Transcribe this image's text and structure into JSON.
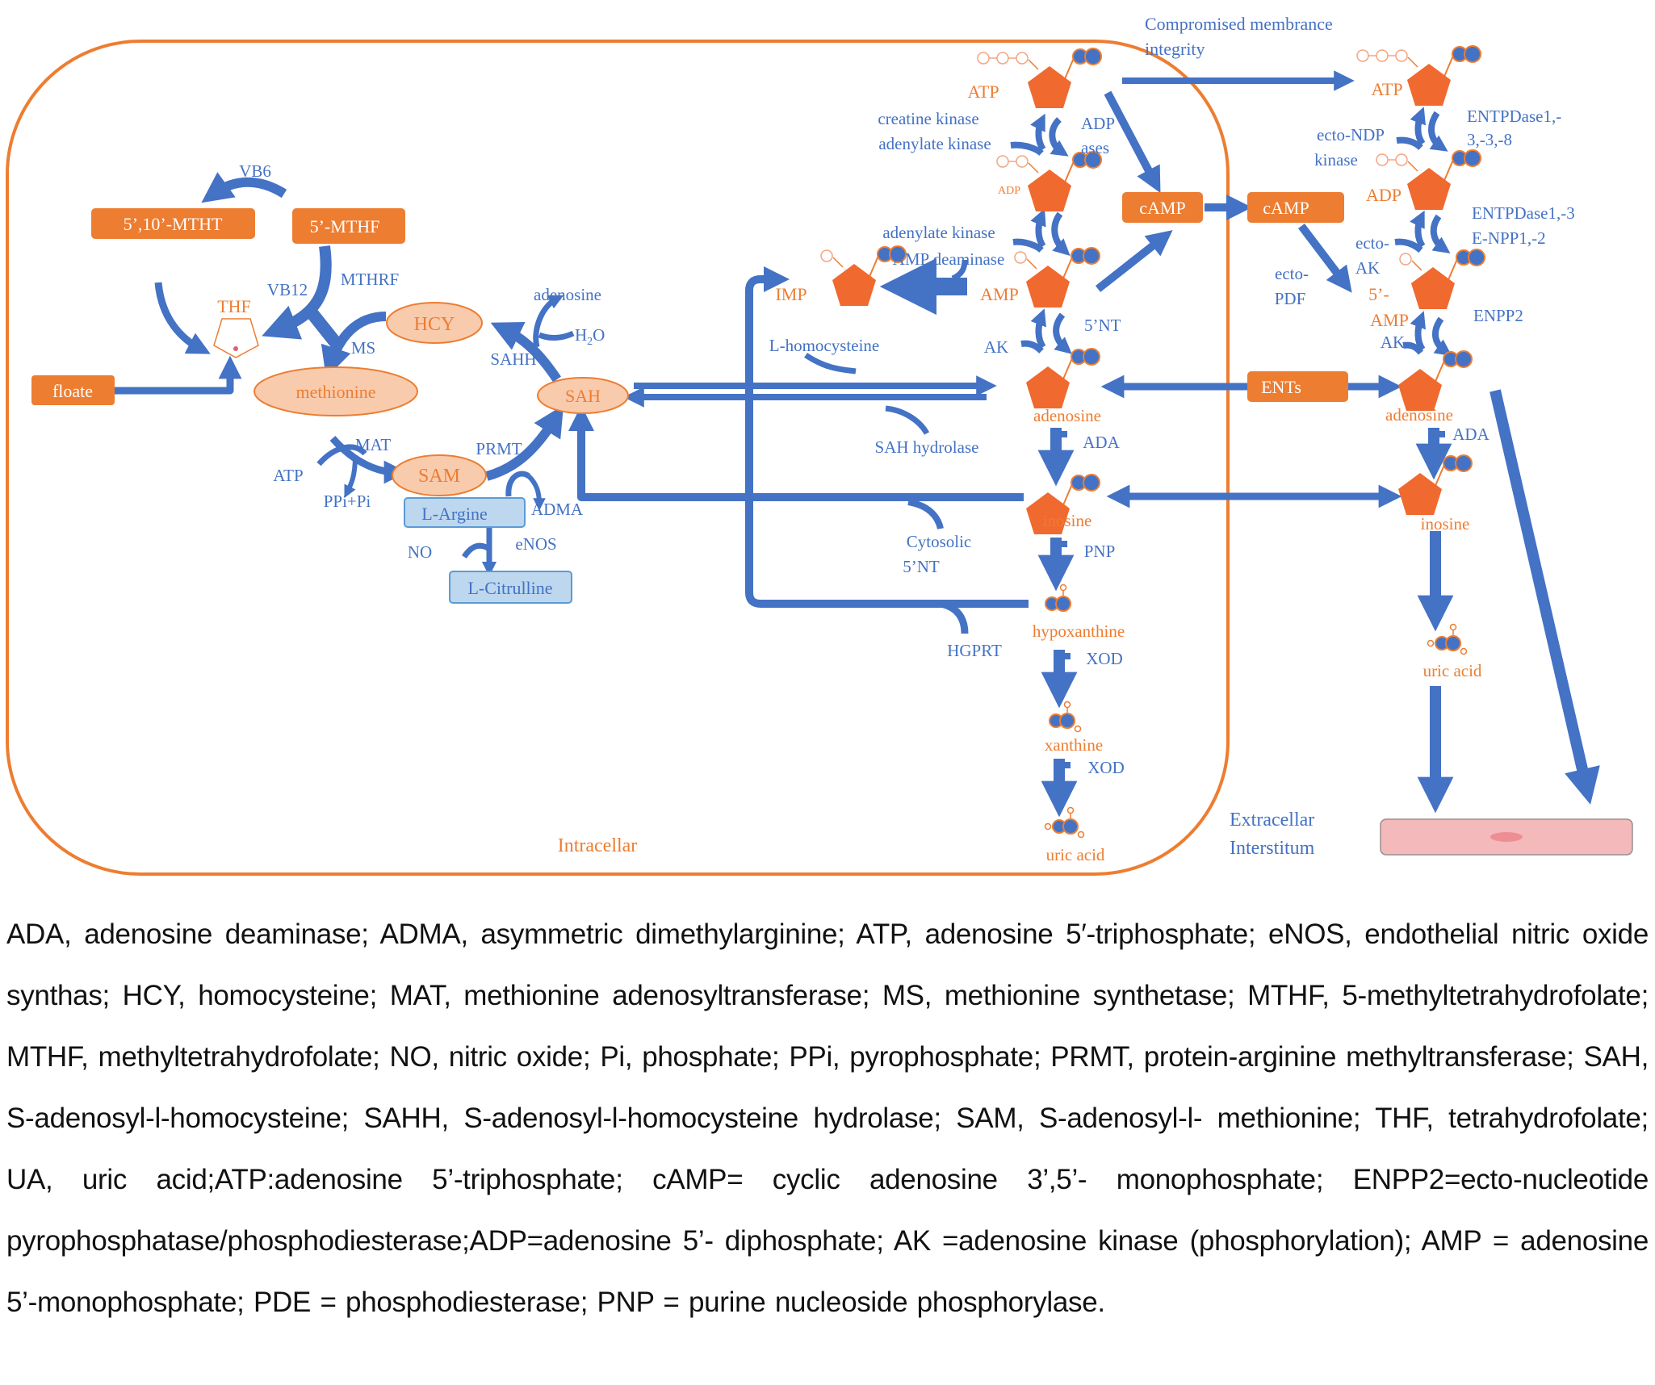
{
  "colors": {
    "blue": "#4472C4",
    "orange": "#ED7D31",
    "pentagon": "#F0692E",
    "ellipse_fill": "#F8CBAD",
    "lightblue_fill": "#BDD7EE",
    "lightblue_stroke": "#5B9BD5",
    "cell_fill": "#F4B9BB",
    "cell_nucleus": "#EE8E93"
  },
  "regions": {
    "intracellular": "Intracellar",
    "extracellular_line1": "Extracellar",
    "extracellular_line2": "Interstitum",
    "membrane_line1": "Compromised membrance",
    "membrane_line2": "integrity"
  },
  "boxes": {
    "mtht": "5’,10’-MTHT",
    "mthf": "5’-MTHF",
    "floate": "floate",
    "camp_in": "cAMP",
    "camp_out": "cAMP",
    "ents": "ENTs",
    "l_argine": "L-Argine",
    "l_citrulline": "L-Citrulline"
  },
  "ellipses": {
    "hcy": "HCY",
    "methionine": "methionine",
    "sah": "SAH",
    "sam": "SAM"
  },
  "metabolites": {
    "thf": "THF",
    "atp_in": "ATP",
    "adp_in": "ADP",
    "amp_in": "AMP",
    "imp": "IMP",
    "adenosine_in": "adenosine",
    "inosine_in": "inosine",
    "hypoxanthine": "hypoxanthine",
    "xanthine": "xanthine",
    "uric_acid_in": "uric acid",
    "atp_out": "ATP",
    "adp_out": "ADP",
    "amp_out_line1": "5’-",
    "amp_out_line2": "AMP",
    "adenosine_out": "adenosine",
    "inosine_out": "inosine",
    "uric_acid_out": "uric acid"
  },
  "enzymes": {
    "vb6": "VB6",
    "vb12": "VB12",
    "mthrf": "MTHRF",
    "ms": "MS",
    "mat": "MAT",
    "atp": "ATP",
    "ppi_pi": "PPi+Pi",
    "prmt": "PRMT",
    "adma": "ADMA",
    "no": "NO",
    "enos": "eNOS",
    "adenosine": "adenosine",
    "h2o": "H",
    "h2o_sub": "2",
    "h2o_end": "O",
    "sahh": "SAHH",
    "creatine_kinase": "creatine kinase",
    "adenylate_kinase_1": "adenylate kinase",
    "adp_ases_1": "ADP",
    "adp_ases_2": "ases",
    "adenylate_kinase_2": "adenylate kinase",
    "amp_deaminase": "AMP deaminase",
    "nt5": "5’NT",
    "ak_in": "AK",
    "l_homocysteine": "L-homocysteine",
    "sah_hydrolase": "SAH hydrolase",
    "ada_in": "ADA",
    "cytosolic_1": "Cytosolic",
    "cytosolic_2": "5’NT",
    "pnp": "PNP",
    "hgprt": "HGPRT",
    "xod_1": "XOD",
    "xod_2": "XOD",
    "ecto_ndp_1": "ecto-NDP",
    "ecto_ndp_2": "kinase",
    "entpdase_a1": "ENTPDase1,-",
    "entpdase_a2": "3,-3,-8",
    "entpdase_b1": "ENTPDase1,-3",
    "entpdase_b2": "E-NPP1,-2",
    "ecto_ak_1": "ecto-",
    "ecto_ak_2": "AK",
    "ecto_pdf_1": "ecto-",
    "ecto_pdf_2": "PDF",
    "enpp2": "ENPP2",
    "ak_out": "AK",
    "ada_out": "ADA"
  },
  "legend": "ADA, adenosine deaminase; ADMA, asymmetric dimethylarginine; ATP, adenosine 5′-triphosphate; eNOS, endothelial nitric oxide synthas; HCY, homocysteine; MAT, methionine adenosyltransferase; MS, methionine synthetase; MTHF, 5-methyltetrahydrofolate; MTHF, methyltetrahydrofolate; NO, nitric oxide; Pi, phosphate; PPi, pyrophosphate; PRMT, protein-arginine methyltransferase; SAH, S-adenosyl-l-homocysteine; SAHH, S-adenosyl-l-homocysteine hydrolase; SAM, S-adenosyl-l- methionine; THF, tetrahydrofolate; UA, uric acid;ATP:adenosine 5’-triphosphate; cAMP= cyclic adenosine 3’,5’- monophosphate; ENPP2=ecto-nucleotide pyrophosphatase/phosphodiesterase;ADP=adenosine 5’- diphosphate; AK =adenosine kinase (phosphorylation); AMP = adenosine 5’-monophosphate; PDE = phosphodiesterase; PNP = purine nucleoside phosphorylase."
}
